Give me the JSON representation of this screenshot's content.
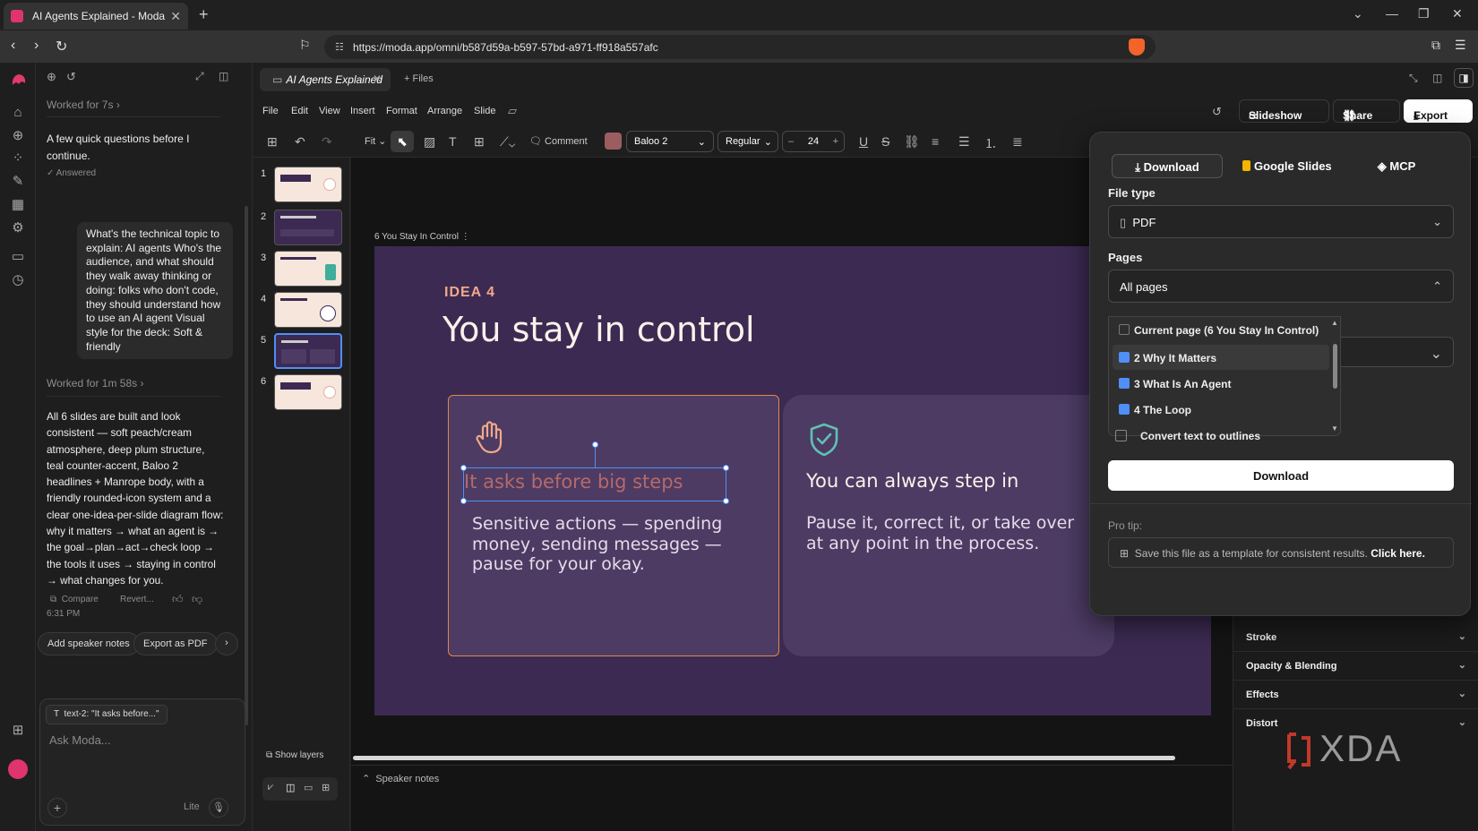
{
  "browser": {
    "tab_title": "AI Agents Explained - Moda",
    "new_tab": "+",
    "url": "https://moda.app/omni/b587d59a-b597-57bd-a971-ff918a557afc"
  },
  "chat": {
    "worked_1": "Worked for 7s",
    "intro": "A few quick questions before I continue.",
    "answered": "Answered",
    "answers": "What's the technical topic to explain: AI agents Who's the audience, and what should they walk away thinking or doing: folks who don't code, they should understand how to use an AI agent Visual style for the deck: Soft & friendly",
    "worked_2": "Worked for 1m 58s",
    "summary": "All 6 slides are built and look consistent — soft peach/cream atmosphere, deep plum structure, teal counter-accent, Baloo 2 headlines + Manrope body, with a friendly rounded-icon system and a clear one-idea-per-slide diagram flow: why it matters → what an agent is → the goal→plan→act→check loop → the tools it uses → staying in control → what changes for you.",
    "compare": "Compare",
    "revert": "Revert...",
    "time": "6:31 PM",
    "chip_1": "Add speaker notes",
    "chip_2": "Export as PDF",
    "context_chip": "text-2: \"It asks before...\"",
    "placeholder": "Ask Moda...",
    "model": "Lite"
  },
  "editor": {
    "doc_tab": "AI Agents Explained",
    "files_tab": "+ Files",
    "menu": [
      "File",
      "Edit",
      "View",
      "Insert",
      "Format",
      "Arrange",
      "Slide"
    ],
    "slideshow": "Slideshow",
    "share": "Share",
    "export": "Export",
    "zoom": "Fit",
    "comment": "Comment",
    "font": "Baloo 2",
    "weight": "Regular",
    "size": "24",
    "text_color": "#9b5d60"
  },
  "thumbnails": {
    "numbers": [
      "1",
      "2",
      "3",
      "4",
      "5",
      "6"
    ],
    "show_layers": "Show layers"
  },
  "slide": {
    "frame_label": "6 You Stay In Control",
    "eyebrow": "IDEA 4",
    "title": "You stay in control",
    "card1_title": "It asks before big steps",
    "card1_body": "Sensitive actions — spending money, sending messages — pause for your okay.",
    "card2_title": "You can always step in",
    "card2_body": "Pause it, correct it, or take over at any point in the process.",
    "colors": {
      "background": "#3c2a52",
      "card": "#4d3b63",
      "accent": "#f0a98a",
      "teal": "#5fc1b4"
    }
  },
  "speaker_notes": "Speaker notes",
  "right_panel": {
    "sections": [
      "Stroke",
      "Opacity & Blending",
      "Effects",
      "Distort"
    ]
  },
  "export_popup": {
    "tabs": [
      "Download",
      "Google Slides",
      "MCP"
    ],
    "file_type_label": "File type",
    "file_type": "PDF",
    "pages_label": "Pages",
    "pages_value": "All pages",
    "page_options": [
      {
        "label": "Current page (6 You Stay In Control)",
        "checked": false
      },
      {
        "label": "2 Why It Matters",
        "checked": true
      },
      {
        "label": "3 What Is An Agent",
        "checked": true
      },
      {
        "label": "4 The Loop",
        "checked": true
      }
    ],
    "outlines": "Convert text to outlines",
    "download_button": "Download",
    "pro_tip_label": "Pro tip:",
    "pro_tip": "Save this file as a template for consistent results.",
    "pro_tip_link": "Click here."
  },
  "watermark": "XDA"
}
